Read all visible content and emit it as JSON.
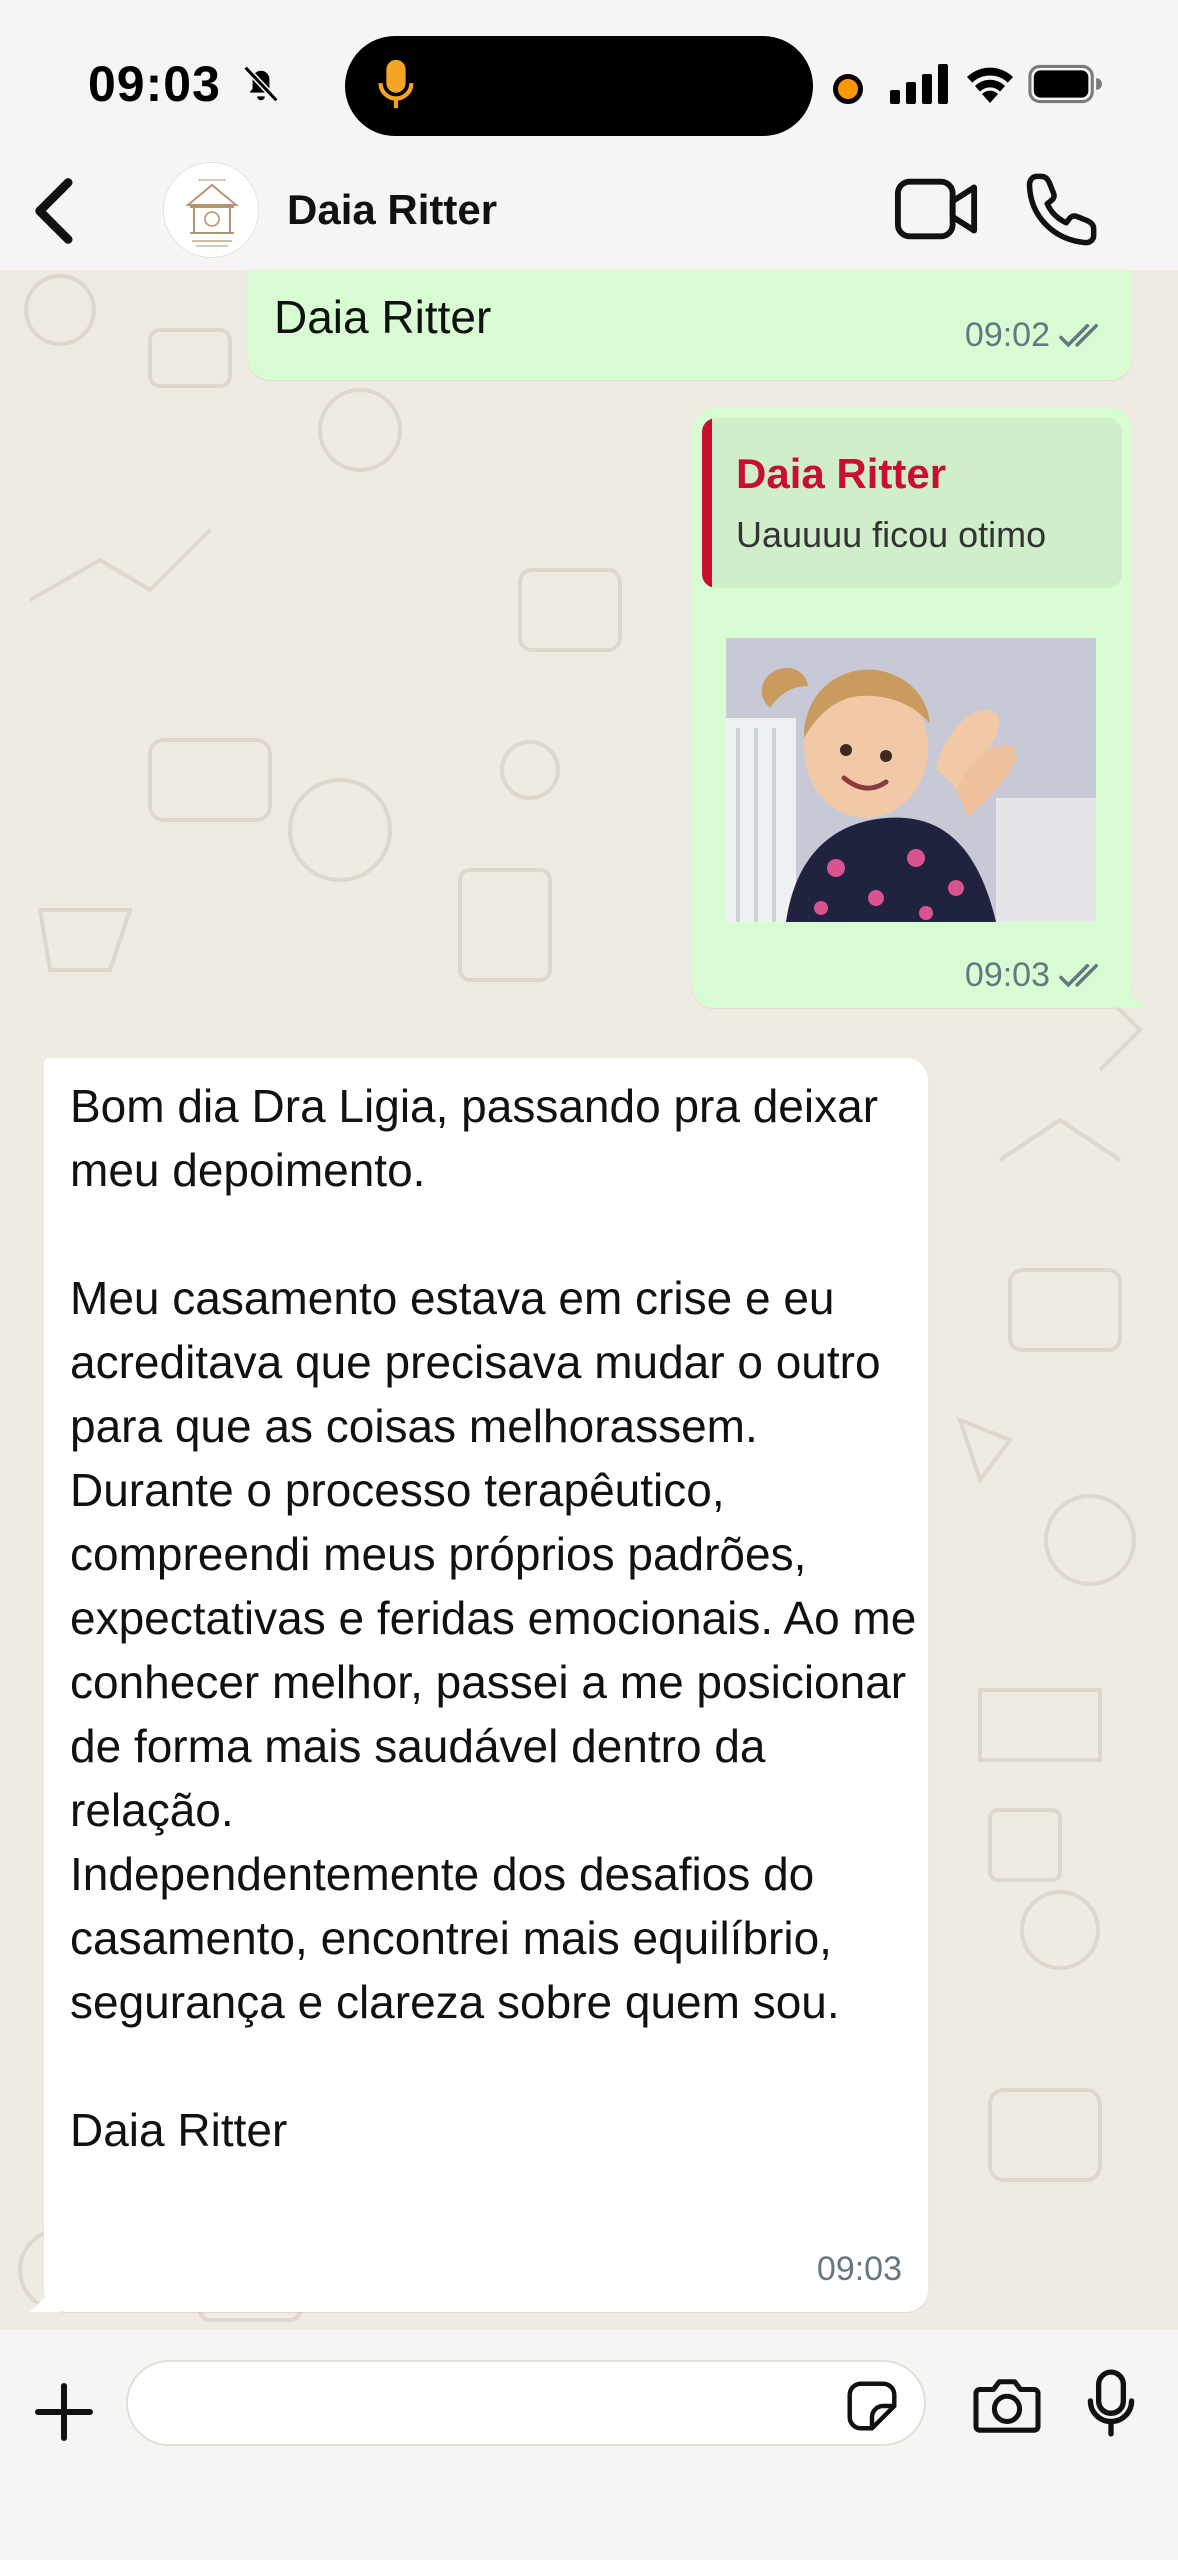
{
  "status_bar": {
    "time": "09:03",
    "icons": [
      "bell-slash-icon",
      "microphone-icon",
      "orange-dot-indicator",
      "cellular-signal-icon",
      "wifi-icon",
      "battery-icon"
    ],
    "mic_color": "#f5a524",
    "dot_color": "#ff9500"
  },
  "header": {
    "contact_name": "Daia Ritter",
    "icons": [
      "chevron-left-icon",
      "video-camera-icon",
      "phone-icon"
    ]
  },
  "messages": [
    {
      "direction": "outgoing",
      "text": "Daia Ritter",
      "time": "09:02",
      "status": "read"
    },
    {
      "direction": "outgoing",
      "quote": {
        "author": "Daia Ritter",
        "text": "Uauuuu ficou otimo",
        "bar_color": "#c8102e"
      },
      "media": "sticker-image",
      "time": "09:03",
      "status": "read"
    },
    {
      "direction": "incoming",
      "text": "Bom dia Dra Ligia, passando pra deixar meu depoimento.\n\nMeu casamento estava em crise e eu acreditava que precisava mudar o outro para que as coisas melhorassem. Durante o processo terapêutico, compreendi meus próprios padrões, expectativas e feridas emocionais. Ao me conhecer melhor, passei a me posicionar de forma mais saudável dentro da relação.\nIndependentemente dos desafios do casamento, encontrei mais equilíbrio, segurança e clareza sobre quem sou.\n\nDaia Ritter",
      "time": "09:03"
    }
  ],
  "input_bar": {
    "placeholder": "",
    "icons": [
      "plus-icon",
      "sticker-icon",
      "camera-icon",
      "microphone-icon"
    ]
  },
  "colors": {
    "outgoing_bubble": "#d9fdd3",
    "incoming_bubble": "#ffffff",
    "wallpaper": "#efeae2",
    "meta_text": "#667781"
  }
}
